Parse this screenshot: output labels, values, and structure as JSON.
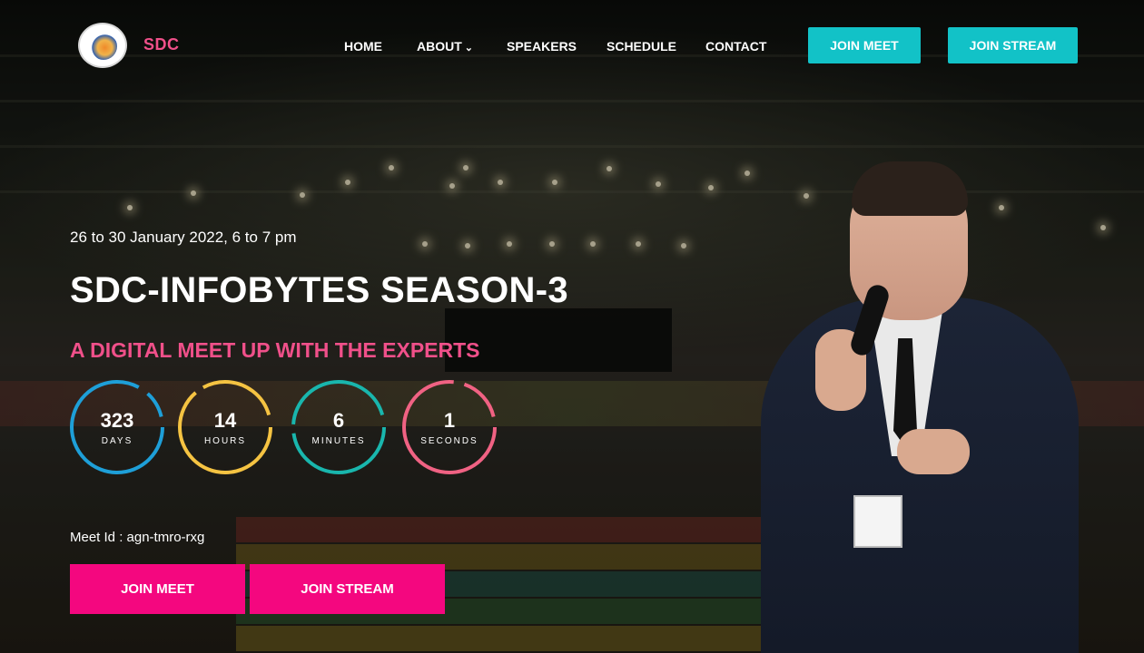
{
  "brand": {
    "name": "SDC",
    "logo_icon": "college-emblem-icon"
  },
  "nav": {
    "items": [
      {
        "label": "HOME"
      },
      {
        "label": "ABOUT",
        "has_dropdown": true,
        "icon": "chevron-down-icon"
      },
      {
        "label": "SPEAKERS"
      },
      {
        "label": "SCHEDULE"
      },
      {
        "label": "CONTACT"
      }
    ],
    "buttons": {
      "join_meet": "JOIN MEET",
      "join_stream": "JOIN STREAM"
    }
  },
  "hero": {
    "date": "26 to 30 January 2022, 6 to 7 pm",
    "title": "SDC-INFOBYTES SEASON-3",
    "subtitle": "A DIGITAL MEET UP WITH THE EXPERTS",
    "countdown": [
      {
        "value": "323",
        "unit": "DAYS",
        "color": "#1e9fd8"
      },
      {
        "value": "14",
        "unit": "HOURS",
        "color": "#f5c342"
      },
      {
        "value": "6",
        "unit": "MINUTES",
        "color": "#19b6ad"
      },
      {
        "value": "1",
        "unit": "SECONDS",
        "color": "#f06283"
      }
    ],
    "meet_id_label": "Meet Id :",
    "meet_id_value": "agn-tmro-rxg",
    "cta": {
      "join_meet": "JOIN MEET",
      "join_stream": "JOIN STREAM"
    }
  },
  "colors": {
    "accent_pink": "#f4077f",
    "brand_pink": "#f0508a",
    "teal": "#12c2c7"
  }
}
